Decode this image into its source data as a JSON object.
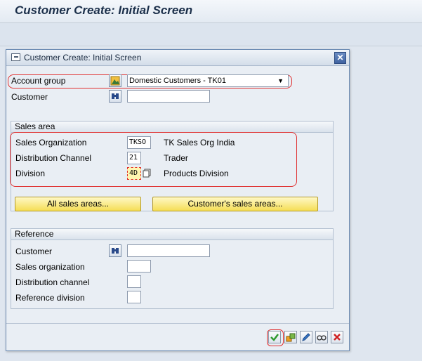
{
  "screen": {
    "title": "Customer Create: Initial Screen"
  },
  "dialog": {
    "title": "Customer Create: Initial Screen",
    "account_group": {
      "label": "Account group",
      "value": "Domestic Customers - TK01"
    },
    "customer": {
      "label": "Customer",
      "value": ""
    },
    "sales_area": {
      "title": "Sales area",
      "sales_org": {
        "label": "Sales Organization",
        "value": "TKSO",
        "description": "TK Sales Org India"
      },
      "dist_channel": {
        "label": "Distribution Channel",
        "value": "21",
        "description": "Trader"
      },
      "division": {
        "label": "Division",
        "value": "4D",
        "description": "Products Division"
      },
      "all_sales_areas_btn": "All sales areas...",
      "customers_sales_areas_btn": "Customer's sales areas..."
    },
    "reference": {
      "title": "Reference",
      "customer_label": "Customer",
      "sales_org_label": "Sales organization",
      "dist_channel_label": "Distribution channel",
      "ref_division_label": "Reference division"
    },
    "colors": {
      "highlight_red": "#e03030",
      "button_yellow": "#f5de55",
      "dialog_bg": "#e9eef4"
    }
  }
}
